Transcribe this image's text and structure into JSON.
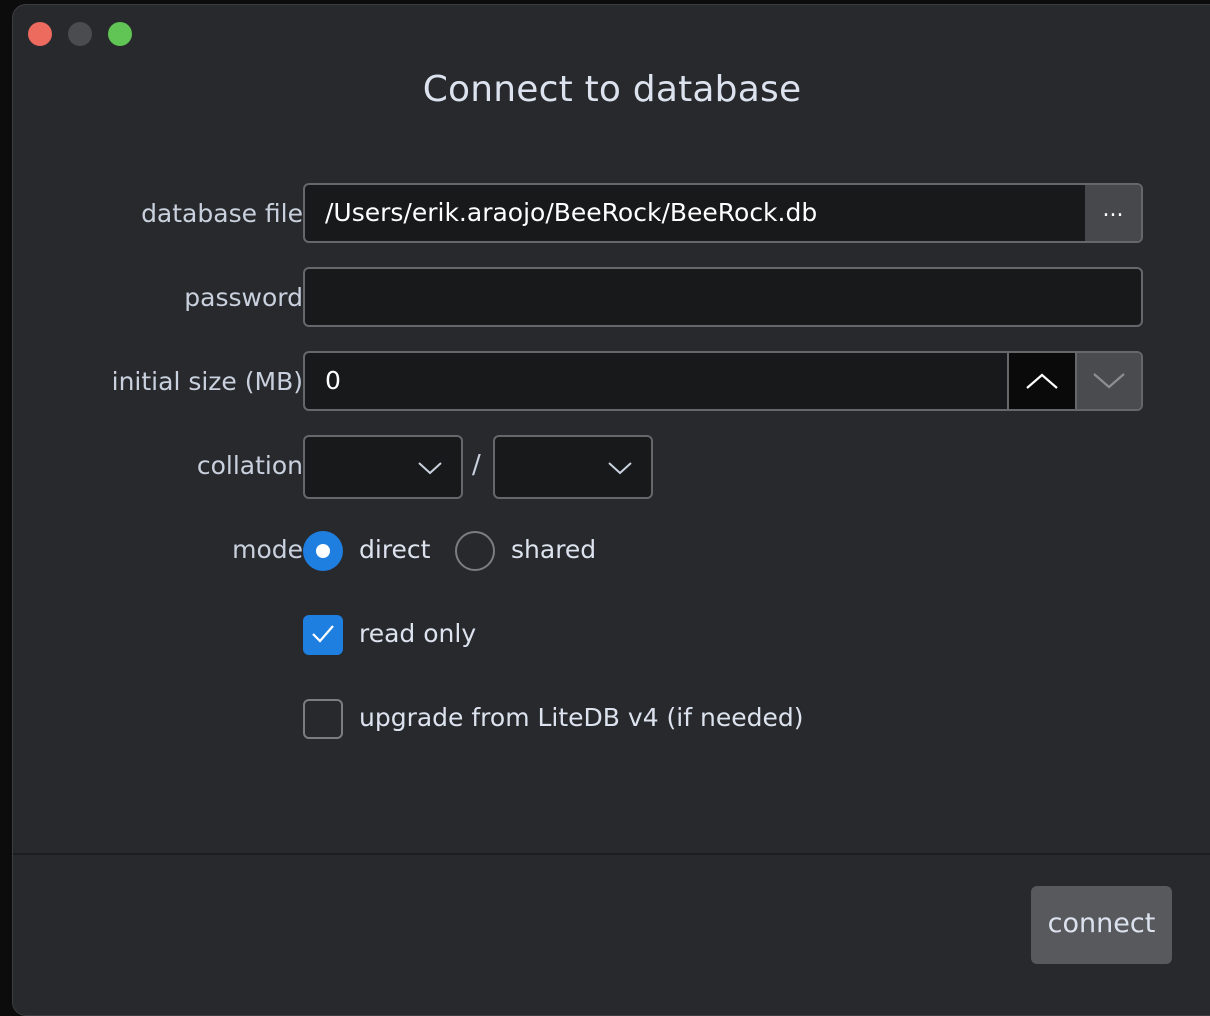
{
  "window": {
    "title": "Connect to database",
    "controls": [
      "close",
      "minimize",
      "maximize"
    ]
  },
  "form": {
    "database_file": {
      "label": "database file",
      "value": "/Users/erik.araojo/BeeRock/BeeRock.db",
      "browse_label": "..."
    },
    "password": {
      "label": "password",
      "value": ""
    },
    "initial_size": {
      "label": "initial size (MB)",
      "value": "0"
    },
    "collation": {
      "label": "collation",
      "separator": "/",
      "left_value": "",
      "right_value": ""
    },
    "mode": {
      "label": "mode",
      "options": [
        {
          "label": "direct",
          "selected": true
        },
        {
          "label": "shared",
          "selected": false
        }
      ]
    },
    "read_only": {
      "label": "read only",
      "checked": true
    },
    "upgrade": {
      "label": "upgrade from LiteDB v4 (if needed)",
      "checked": false
    }
  },
  "footer": {
    "connect_label": "connect"
  },
  "colors": {
    "accent": "#1f7fe0",
    "window_bg": "#28292c",
    "field_bg": "#18191b"
  }
}
